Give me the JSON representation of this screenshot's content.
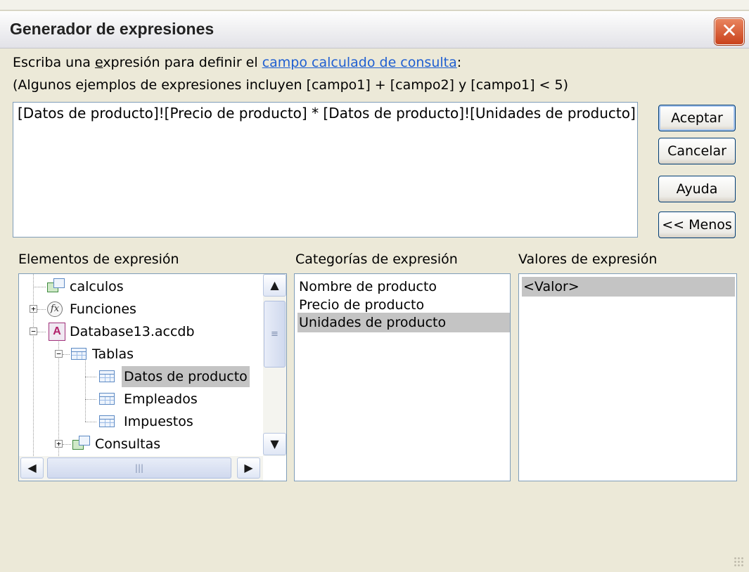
{
  "window": {
    "title": "Generador de expresiones",
    "close_glyph": "✕"
  },
  "instructions": {
    "line1_prefix": "Escriba una ",
    "line1_accel": "e",
    "line1_mid": "xpresión para definir el ",
    "line1_link": "campo calculado de consulta",
    "line1_suffix": ":",
    "line2": "(Algunos ejemplos de expresiones incluyen [campo1] + [campo2] y [campo1] < 5)"
  },
  "expression": {
    "value": "[Datos de producto]![Precio de producto] * [Datos de producto]![Unidades de producto]"
  },
  "buttons": {
    "ok": "Aceptar",
    "cancel": "Cancelar",
    "help": "Ayuda",
    "less": "<< Menos"
  },
  "sections": {
    "elements_label": "Elementos de expresión",
    "categories_label": "Categorías de expresión",
    "values_label": "Valores de expresión"
  },
  "tree": {
    "items": [
      {
        "label": "calculos",
        "icon": "query-icon"
      },
      {
        "label": "Funciones",
        "icon": "function-icon",
        "expander": "+"
      },
      {
        "label": "Database13.accdb",
        "icon": "access-database-icon",
        "expander": "−"
      },
      {
        "label": "Tablas",
        "icon": "table-icon",
        "expander": "−"
      },
      {
        "label": "Datos de producto",
        "icon": "table-icon",
        "selected": true
      },
      {
        "label": "Empleados",
        "icon": "table-icon"
      },
      {
        "label": "Impuestos",
        "icon": "table-icon"
      },
      {
        "label": "Consultas",
        "icon": "query-icon",
        "expander": "+"
      }
    ]
  },
  "categories": {
    "items": [
      "Nombre de producto",
      "Precio de producto",
      "Unidades de producto"
    ],
    "selected_index": 2
  },
  "values": {
    "items": [
      "<Valor>"
    ],
    "selected_index": 0
  },
  "scroll": {
    "up": "▲",
    "down": "▼",
    "left": "◀",
    "right": "▶",
    "grip_v": "≡",
    "grip_h": "|||"
  },
  "colors": {
    "selection": "#c4c4c4",
    "link": "#1f5fd1",
    "close_button": "#c9421c",
    "dialog_bg": "#ece9d8"
  }
}
